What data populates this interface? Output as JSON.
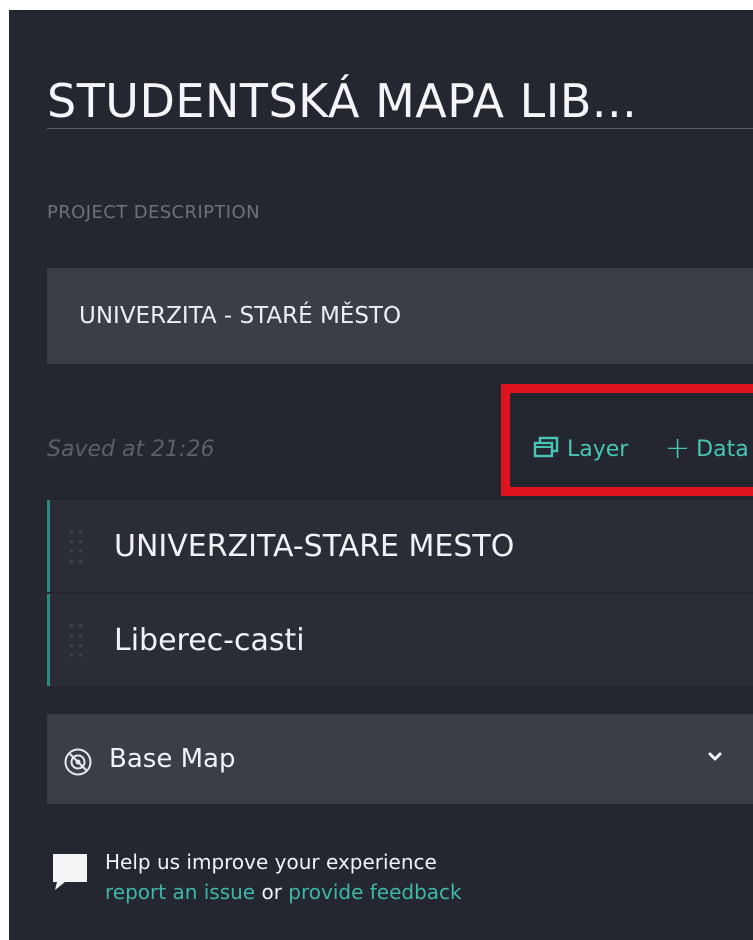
{
  "header": {
    "title": "STUDENTSKÁ MAPA LIB..."
  },
  "description": {
    "section_label": "PROJECT DESCRIPTION",
    "value": "UNIVERZITA - STARÉ MĚSTO"
  },
  "status": {
    "saved_text": "Saved at 21:26"
  },
  "toolbar": {
    "layer_label": "Layer",
    "data_label": "Data",
    "data_plus": "+"
  },
  "layers": {
    "items": [
      {
        "label": "UNIVERZITA-STARE MESTO"
      },
      {
        "label": "Liberec-casti"
      }
    ]
  },
  "basemap": {
    "label": "Base Map",
    "icon": "basemap-icon"
  },
  "feedback": {
    "line1": "Help us improve your experience",
    "report_link": "report an issue",
    "or_text": "or",
    "feedback_link": "provide feedback"
  },
  "colors": {
    "panel_bg": "#24272f",
    "accent": "#49c5b6",
    "highlight": "#e0141e"
  }
}
